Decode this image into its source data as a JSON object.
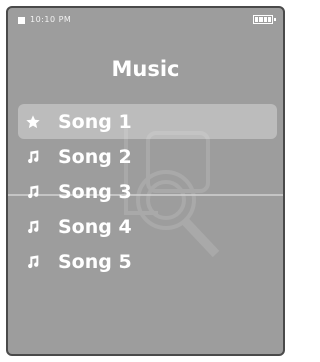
{
  "status": {
    "time": "10:10 PM"
  },
  "screen": {
    "title": "Music"
  },
  "songs": [
    {
      "label": "Song 1",
      "icon": "star-icon",
      "selected": true
    },
    {
      "label": "Song 2",
      "icon": "music-note-icon",
      "selected": false
    },
    {
      "label": "Song 3",
      "icon": "music-note-icon",
      "selected": false
    },
    {
      "label": "Song 4",
      "icon": "music-note-icon",
      "selected": false
    },
    {
      "label": "Song 5",
      "icon": "music-note-icon",
      "selected": false
    }
  ],
  "colors": {
    "screen_background": "#9d9d9d",
    "text": "#ffffff",
    "selection_highlight": "rgba(255,255,255,0.32)"
  }
}
